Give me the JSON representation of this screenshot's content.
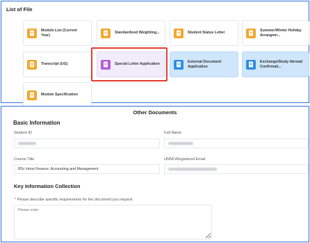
{
  "file_list": {
    "title": "List of File",
    "cards": [
      {
        "label": "Module List (Current Year)",
        "icon": "document-icon",
        "color": "#f4a72c"
      },
      {
        "label": "Standardized Weighting...",
        "icon": "document-icon",
        "color": "#f4a72c"
      },
      {
        "label": "Student Status Letter",
        "icon": "document-icon",
        "color": "#f4a72c"
      },
      {
        "label": "Summer/Winter Holiday Arrangem...",
        "icon": "document-icon",
        "color": "#f4a72c"
      },
      {
        "label": "Transcript (UG)",
        "icon": "transcript-icon",
        "color": "#f4a72c"
      },
      {
        "label": "Special Letter Application",
        "icon": "document-icon",
        "color": "#b65cdc"
      },
      {
        "label": "External Document Application",
        "icon": "document-icon",
        "color": "#2f8de4"
      },
      {
        "label": "Exchange/Study Abroad Confirmati...",
        "icon": "document-icon",
        "color": "#2f8de4"
      },
      {
        "label": "Module Specification",
        "icon": "document-icon",
        "color": "#f4a72c"
      }
    ]
  },
  "other_documents": {
    "title": "Other Documents",
    "basic_info": {
      "heading": "Basic Information",
      "student_id_label": "Student ID",
      "full_name_label": "Full Name",
      "course_title_label": "Course Title",
      "course_title_value": "BSc Hons Finance, Accounting and Management",
      "email_label": "UNNC/Registered Email"
    },
    "key_info": {
      "heading": "Key Information Collection",
      "requirements_label": "Please describe specific requirements for the document you request",
      "requirements_placeholder": "Please enter"
    }
  },
  "colors": {
    "panel_border": "#2f6fd6",
    "highlight": "#e03c31"
  }
}
